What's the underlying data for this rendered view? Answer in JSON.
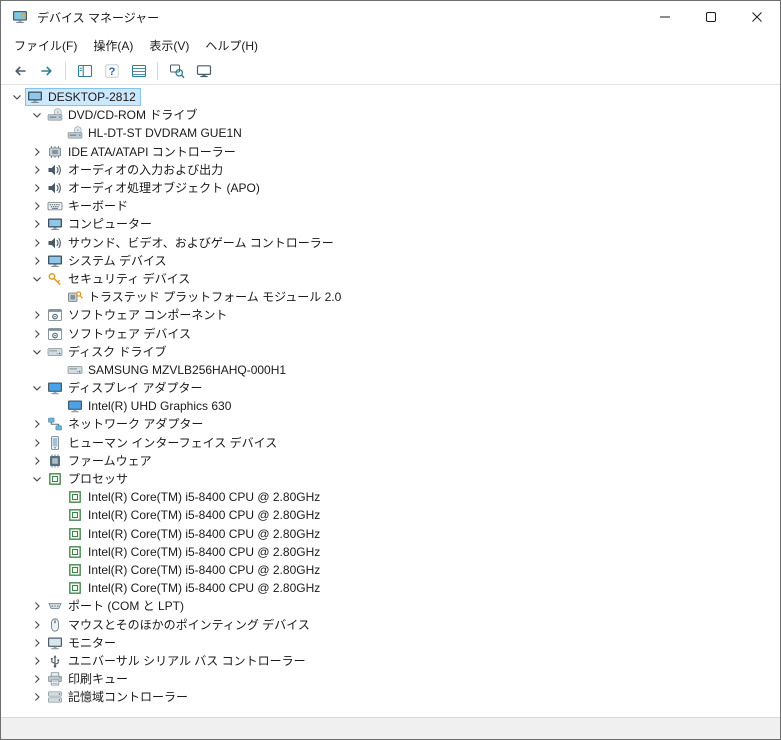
{
  "window": {
    "title": "デバイス マネージャー",
    "app_icon": "device-manager-app-icon"
  },
  "menu": {
    "items": [
      {
        "key": "file",
        "label": "ファイル(F)"
      },
      {
        "key": "action",
        "label": "操作(A)"
      },
      {
        "key": "view",
        "label": "表示(V)"
      },
      {
        "key": "help",
        "label": "ヘルプ(H)"
      }
    ]
  },
  "toolbar": {
    "items": [
      {
        "type": "button",
        "name": "back-button",
        "icon": "back-arrow-icon"
      },
      {
        "type": "button",
        "name": "forward-button",
        "icon": "forward-arrow-icon"
      },
      {
        "type": "separator"
      },
      {
        "type": "button",
        "name": "show-console-tree-button",
        "icon": "console-tree-icon"
      },
      {
        "type": "button",
        "name": "help-button",
        "icon": "help-icon"
      },
      {
        "type": "button",
        "name": "list-view-button",
        "icon": "list-view-icon"
      },
      {
        "type": "separator"
      },
      {
        "type": "button",
        "name": "scan-hardware-button",
        "icon": "scan-hardware-icon"
      },
      {
        "type": "button",
        "name": "remote-computer-button",
        "icon": "remote-computer-icon"
      }
    ]
  },
  "tree": {
    "nodes": [
      {
        "level": 0,
        "state": "expanded",
        "icon": "computer-icon",
        "label": "DESKTOP-2812",
        "selected": true
      },
      {
        "level": 1,
        "state": "expanded",
        "icon": "dvd-drive-icon",
        "label": "DVD/CD-ROM ドライブ"
      },
      {
        "level": 2,
        "state": "none",
        "icon": "dvd-drive-icon",
        "label": "HL-DT-ST DVDRAM GUE1N"
      },
      {
        "level": 1,
        "state": "collapsed",
        "icon": "ide-controller-icon",
        "label": "IDE ATA/ATAPI コントローラー"
      },
      {
        "level": 1,
        "state": "collapsed",
        "icon": "audio-endpoint-icon",
        "label": "オーディオの入力および出力"
      },
      {
        "level": 1,
        "state": "collapsed",
        "icon": "audio-processing-icon",
        "label": "オーディオ処理オブジェクト (APO)"
      },
      {
        "level": 1,
        "state": "collapsed",
        "icon": "keyboard-icon",
        "label": "キーボード"
      },
      {
        "level": 1,
        "state": "collapsed",
        "icon": "computer-category-icon",
        "label": "コンピューター"
      },
      {
        "level": 1,
        "state": "collapsed",
        "icon": "sound-controller-icon",
        "label": "サウンド、ビデオ、およびゲーム コントローラー"
      },
      {
        "level": 1,
        "state": "collapsed",
        "icon": "system-device-icon",
        "label": "システム デバイス"
      },
      {
        "level": 1,
        "state": "expanded",
        "icon": "security-device-icon",
        "label": "セキュリティ デバイス"
      },
      {
        "level": 2,
        "state": "none",
        "icon": "tpm-icon",
        "label": "トラステッド プラットフォーム モジュール 2.0"
      },
      {
        "level": 1,
        "state": "collapsed",
        "icon": "software-component-icon",
        "label": "ソフトウェア コンポーネント"
      },
      {
        "level": 1,
        "state": "collapsed",
        "icon": "software-device-icon",
        "label": "ソフトウェア デバイス"
      },
      {
        "level": 1,
        "state": "expanded",
        "icon": "disk-drive-icon",
        "label": "ディスク ドライブ"
      },
      {
        "level": 2,
        "state": "none",
        "icon": "disk-drive-icon",
        "label": "SAMSUNG MZVLB256HAHQ-000H1"
      },
      {
        "level": 1,
        "state": "expanded",
        "icon": "display-adapter-icon",
        "label": "ディスプレイ アダプター"
      },
      {
        "level": 2,
        "state": "none",
        "icon": "display-adapter-icon",
        "label": "Intel(R) UHD Graphics 630"
      },
      {
        "level": 1,
        "state": "collapsed",
        "icon": "network-adapter-icon",
        "label": "ネットワーク アダプター"
      },
      {
        "level": 1,
        "state": "collapsed",
        "icon": "hid-icon",
        "label": "ヒューマン インターフェイス デバイス"
      },
      {
        "level": 1,
        "state": "collapsed",
        "icon": "firmware-icon",
        "label": "ファームウェア"
      },
      {
        "level": 1,
        "state": "expanded",
        "icon": "processor-icon",
        "label": "プロセッサ"
      },
      {
        "level": 2,
        "state": "none",
        "icon": "processor-icon",
        "label": "Intel(R) Core(TM) i5-8400 CPU @ 2.80GHz"
      },
      {
        "level": 2,
        "state": "none",
        "icon": "processor-icon",
        "label": "Intel(R) Core(TM) i5-8400 CPU @ 2.80GHz"
      },
      {
        "level": 2,
        "state": "none",
        "icon": "processor-icon",
        "label": "Intel(R) Core(TM) i5-8400 CPU @ 2.80GHz"
      },
      {
        "level": 2,
        "state": "none",
        "icon": "processor-icon",
        "label": "Intel(R) Core(TM) i5-8400 CPU @ 2.80GHz"
      },
      {
        "level": 2,
        "state": "none",
        "icon": "processor-icon",
        "label": "Intel(R) Core(TM) i5-8400 CPU @ 2.80GHz"
      },
      {
        "level": 2,
        "state": "none",
        "icon": "processor-icon",
        "label": "Intel(R) Core(TM) i5-8400 CPU @ 2.80GHz"
      },
      {
        "level": 1,
        "state": "collapsed",
        "icon": "ports-icon",
        "label": "ポート (COM と LPT)"
      },
      {
        "level": 1,
        "state": "collapsed",
        "icon": "mouse-icon",
        "label": "マウスとそのほかのポインティング デバイス"
      },
      {
        "level": 1,
        "state": "collapsed",
        "icon": "monitor-icon",
        "label": "モニター"
      },
      {
        "level": 1,
        "state": "collapsed",
        "icon": "usb-icon",
        "label": "ユニバーサル シリアル バス コントローラー"
      },
      {
        "level": 1,
        "state": "collapsed",
        "icon": "print-queue-icon",
        "label": "印刷キュー"
      },
      {
        "level": 1,
        "state": "collapsed",
        "icon": "storage-controller-icon",
        "label": "記憶域コントローラー"
      }
    ]
  },
  "statusbar": {
    "text": ""
  },
  "colors": {
    "selection_bg": "#cce8ff",
    "selection_border": "#84c3f0",
    "toolbar_accent": "#2e7f8f",
    "processor_green": "#41804a",
    "key_gold": "#d99e2b"
  }
}
